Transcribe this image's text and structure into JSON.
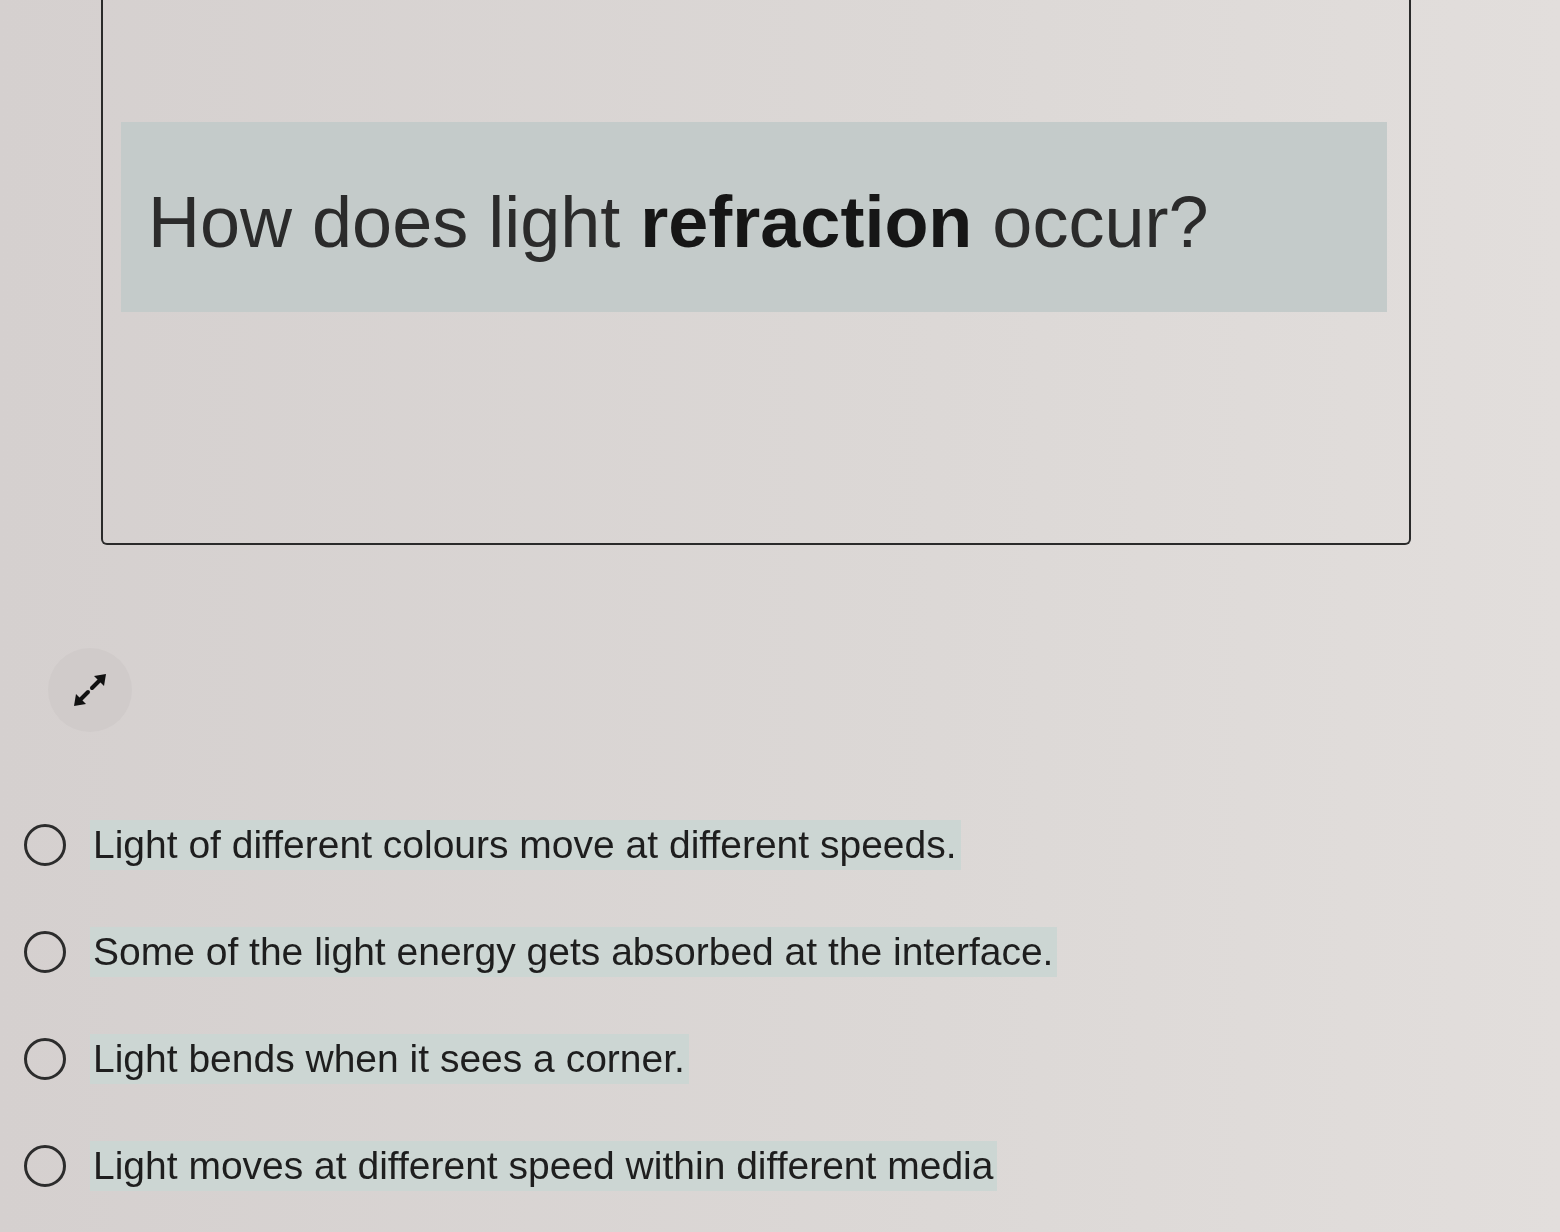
{
  "question": {
    "text": "How does light **refraction** occur?"
  },
  "options": [
    {
      "label": "Light of different colours move at different speeds.",
      "selected": false
    },
    {
      "label": "Some of the light energy gets absorbed at the interface.",
      "selected": false
    },
    {
      "label": "Light bends when it sees a corner.",
      "selected": false
    },
    {
      "label": "Light moves at different speed within different media",
      "selected": false
    }
  ]
}
